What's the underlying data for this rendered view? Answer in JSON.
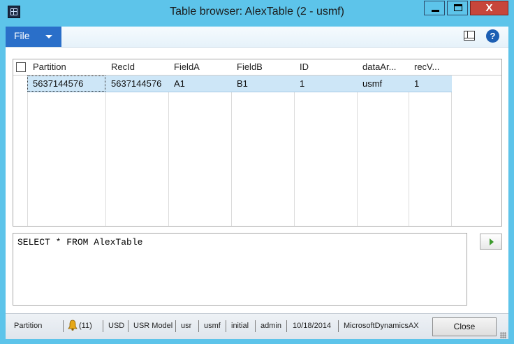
{
  "window": {
    "title": "Table browser: AlexTable (2 - usmf)",
    "close_glyph": "X"
  },
  "ribbon": {
    "file_label": "File",
    "help_glyph": "?"
  },
  "grid": {
    "columns": [
      "Partition",
      "RecId",
      "FieldA",
      "FieldB",
      "ID",
      "dataAr...",
      "recV..."
    ],
    "rows": [
      [
        "5637144576",
        "5637144576",
        "A1",
        "B1",
        "1",
        "usmf",
        "1"
      ]
    ]
  },
  "query": {
    "text": "SELECT * FROM AlexTable"
  },
  "statusbar": {
    "partition": "Partition",
    "notifications": "(11)",
    "currency": "USD",
    "model": "USR Model",
    "layer": "usr",
    "company": "usmf",
    "state": "initial",
    "user": "admin",
    "date": "10/18/2014",
    "database": "MicrosoftDynamicsAX",
    "close_label": "Close"
  },
  "colors": {
    "window_frame": "#5dc4ea",
    "file_button": "#2a6fc9",
    "selected_row": "#cde6f7",
    "close_caption": "#c7463b"
  }
}
